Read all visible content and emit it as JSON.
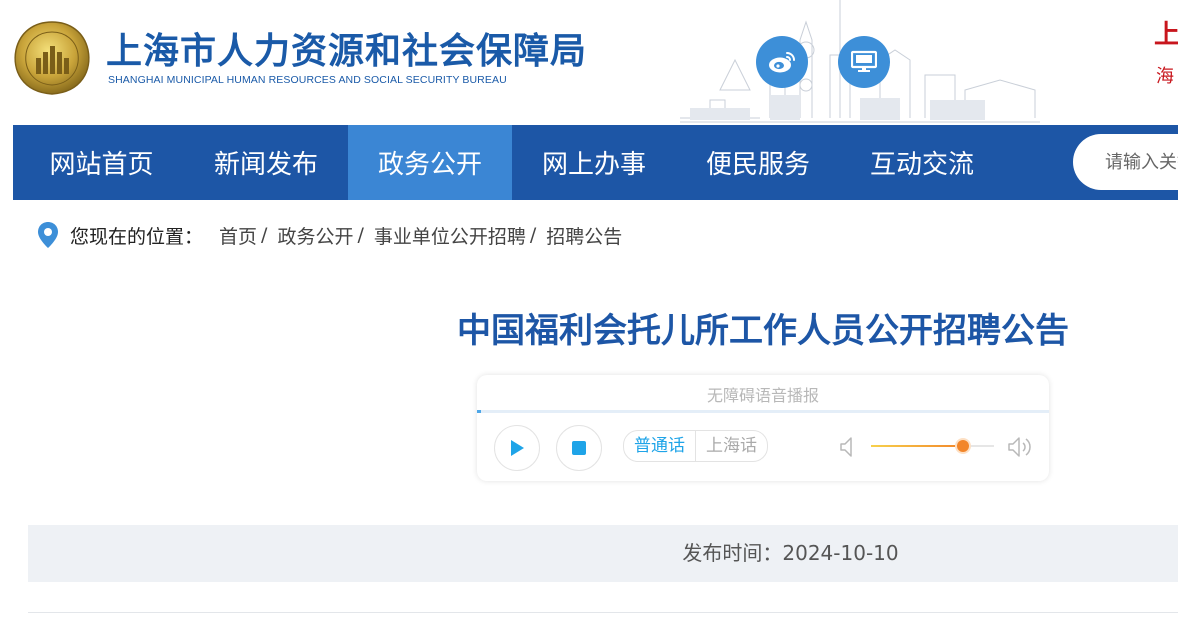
{
  "header": {
    "title": "上海市人力资源和社会保障局",
    "subtitle": "SHANGHAI MUNICIPAL HUMAN RESOURCES AND SOCIAL SECURITY BUREAU",
    "corner_title": "上",
    "corner_sub": "海"
  },
  "social": [
    {
      "icon": "weibo-icon"
    },
    {
      "icon": "monitor-icon"
    }
  ],
  "nav": {
    "items": [
      {
        "label": "网站首页",
        "active": false
      },
      {
        "label": "新闻发布",
        "active": false
      },
      {
        "label": "政务公开",
        "active": true
      },
      {
        "label": "网上办事",
        "active": false
      },
      {
        "label": "便民服务",
        "active": false
      },
      {
        "label": "互动交流",
        "active": false
      }
    ],
    "search_placeholder": "请输入关键字"
  },
  "breadcrumb": {
    "label": "您现在的位置：",
    "items": [
      "首页",
      "政务公开",
      "事业单位公开招聘",
      "招聘公告"
    ],
    "separator": "/"
  },
  "article": {
    "title": "中国福利会托儿所工作人员公开招聘公告",
    "publish_label": "发布时间：",
    "publish_date": "2024-10-10",
    "publish_full": "发布时间：2024-10-10"
  },
  "audio": {
    "title": "无障碍语音播报",
    "languages": [
      {
        "label": "普通话",
        "selected": true
      },
      {
        "label": "上海话",
        "selected": false
      }
    ],
    "volume": 0.75
  },
  "colors": {
    "nav_bg": "#1d56a6",
    "nav_active": "#3b86d4",
    "title": "#1d56a6",
    "accent": "#1fa4e8"
  }
}
